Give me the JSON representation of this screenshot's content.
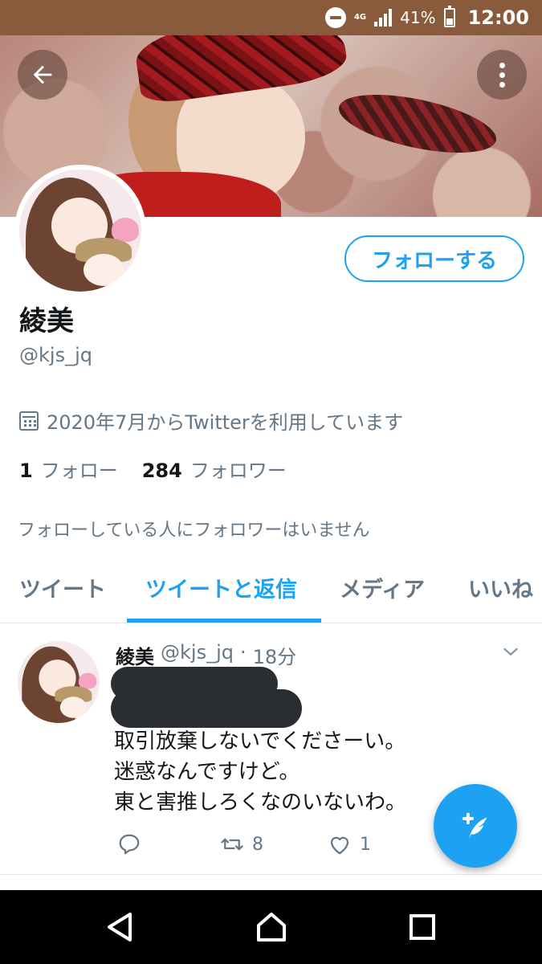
{
  "status_bar": {
    "network": "4G",
    "battery_percent": "41%",
    "time": "12:00"
  },
  "profile": {
    "follow_button": "フォローする",
    "name": "綾美",
    "handle": "@kjs_jq",
    "joined": "2020年7月からTwitterを利用しています",
    "following_count": "1",
    "following_label": "フォロー",
    "followers_count": "284",
    "followers_label": "フォロワー",
    "no_mutual_followers": "フォローしている人にフォロワーはいません"
  },
  "tabs": [
    {
      "label": "ツイート",
      "active": false
    },
    {
      "label": "ツイートと返信",
      "active": true
    },
    {
      "label": "メディア",
      "active": false
    },
    {
      "label": "いいね",
      "active": false
    }
  ],
  "tweet": {
    "name": "綾美",
    "handle": "@kjs_jq",
    "separator": "·",
    "time": "18分",
    "lines": [
      "取引放棄しないでくださーい。",
      "迷惑なんですけど。",
      "東と害推しろくなのいないわ。"
    ],
    "retweets": "8",
    "likes": "1"
  },
  "colors": {
    "accent": "#1da1f2",
    "status_bar": "#8a5a3c",
    "secondary_text": "#657786"
  },
  "icons": {
    "back": "arrow-left-icon",
    "more": "more-vertical-icon",
    "calendar": "calendar-icon",
    "reply": "reply-icon",
    "retweet": "retweet-icon",
    "like": "heart-icon",
    "compose": "compose-tweet-icon"
  }
}
